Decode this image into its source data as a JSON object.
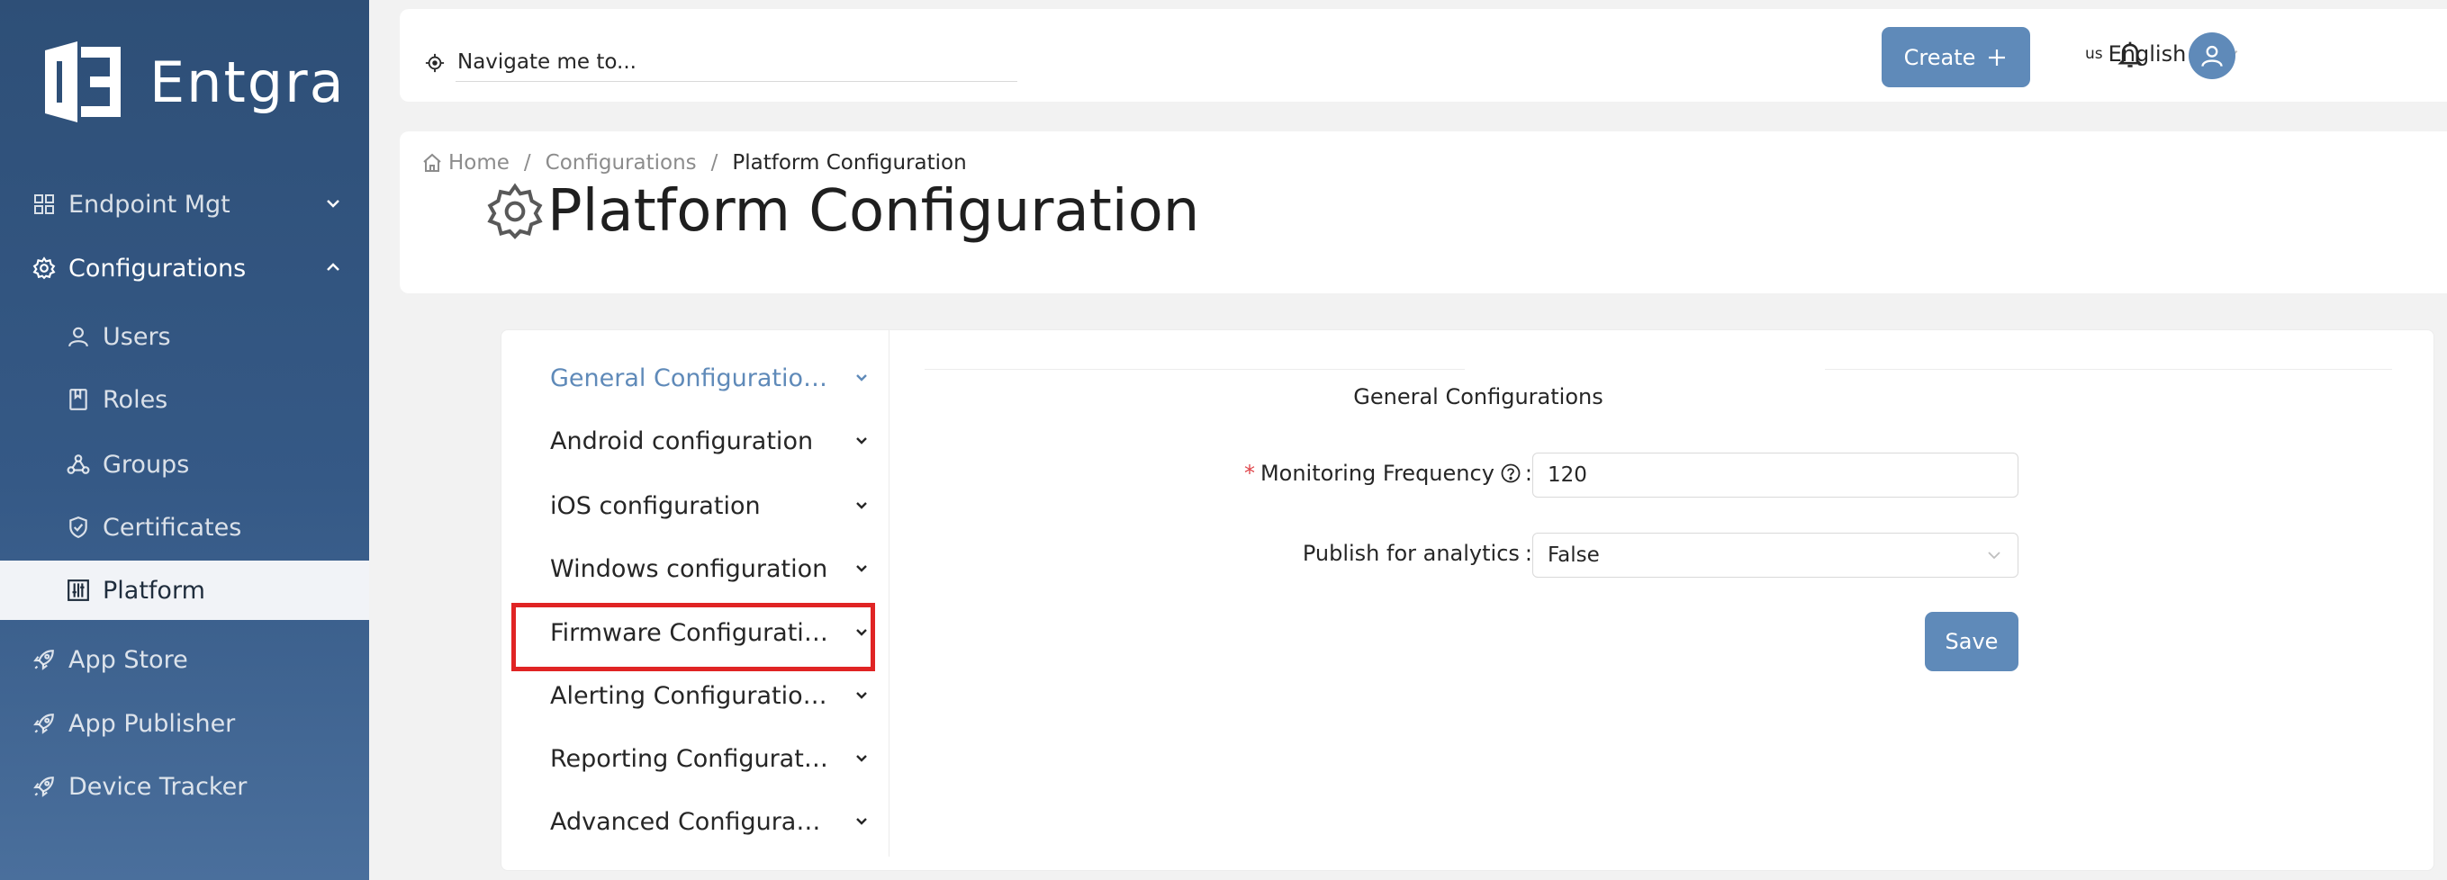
{
  "sidebar": {
    "logo_text": "Entgra",
    "items": [
      {
        "label": "Endpoint Mgt",
        "icon": "grid-icon"
      },
      {
        "label": "Configurations",
        "icon": "gear-icon"
      },
      {
        "label": "Users",
        "icon": "user-icon"
      },
      {
        "label": "Roles",
        "icon": "book-icon"
      },
      {
        "label": "Groups",
        "icon": "groups-icon"
      },
      {
        "label": "Certificates",
        "icon": "shield-icon"
      },
      {
        "label": "Platform",
        "icon": "sliders-icon"
      },
      {
        "label": "App Store",
        "icon": "rocket-icon"
      },
      {
        "label": "App Publisher",
        "icon": "rocket-icon"
      },
      {
        "label": "Device Tracker",
        "icon": "rocket-icon"
      }
    ]
  },
  "topbar": {
    "search_placeholder": "Navigate me to...",
    "create_label": "Create",
    "language_code": "us",
    "language": "English"
  },
  "header": {
    "breadcrumb": [
      "Home",
      "Configurations",
      "Platform Configuration"
    ],
    "title": "Platform Configuration"
  },
  "config_menu": {
    "items": [
      "General Configurations",
      "Android configuration",
      "iOS configuration",
      "Windows configuration",
      "Firmware Configuration",
      "Alerting Configurations",
      "Reporting Configurations",
      "Advanced Configurations"
    ]
  },
  "form": {
    "section_title": "General Configurations",
    "monitoring_label": "Monitoring Frequency",
    "monitoring_value": "120",
    "analytics_label": "Publish for analytics",
    "analytics_value": "False",
    "save_label": "Save",
    "colon": ":",
    "required_mark": "*"
  },
  "colors": {
    "sidebar_bg": "#2e4f77",
    "accent": "#5f8ab9",
    "highlight": "#e02424"
  }
}
